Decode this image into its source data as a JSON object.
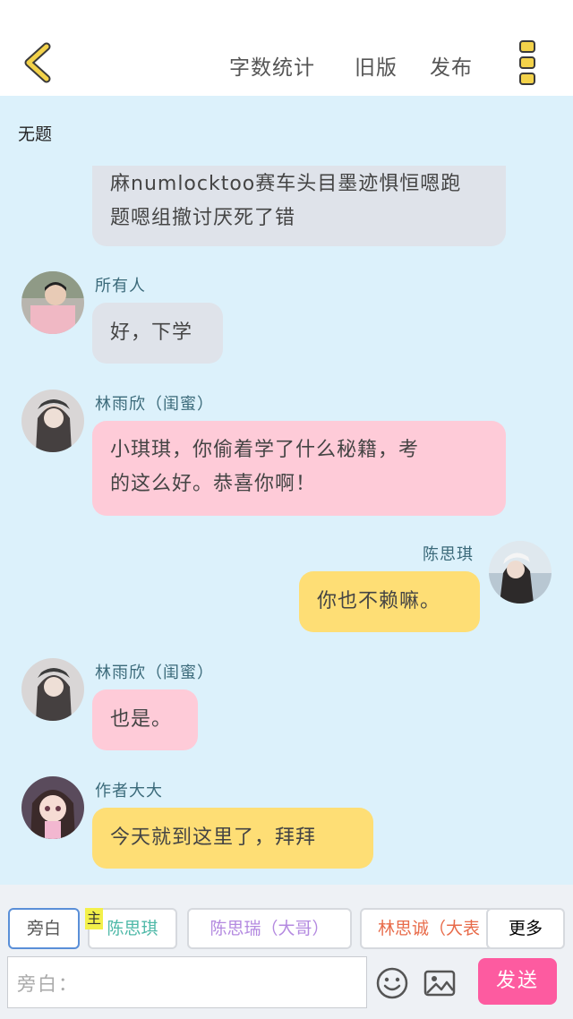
{
  "header": {
    "word_count_label": "字数统计",
    "old_version_label": "旧版",
    "publish_label": "发布"
  },
  "doc": {
    "title": "无题"
  },
  "messages": [
    {
      "sender": "",
      "text_lines": [
        "麻numlocktoo赛车头目墨迹惧恒嗯跑",
        "题嗯组撤讨厌死了错"
      ],
      "color": "gray"
    },
    {
      "sender": "所有人",
      "text": "好，下学",
      "color": "gray"
    },
    {
      "sender": "林雨欣（闺蜜）",
      "text_lines": [
        "小琪琪，你偷着学了什么秘籍，考",
        "的这么好。恭喜你啊！"
      ],
      "color": "pink"
    },
    {
      "sender": "陈思琪",
      "text": "你也不赖嘛。",
      "color": "yellow"
    },
    {
      "sender": "林雨欣（闺蜜）",
      "text": "也是。",
      "color": "pink"
    },
    {
      "sender": "作者大大",
      "text": "今天就到这里了，拜拜",
      "color": "yellow"
    }
  ],
  "roles": {
    "narration": "旁白",
    "main_tag": "主",
    "chen_siqi": "陈思琪",
    "chen_sirui": "陈思瑞（大哥）",
    "lin_sicheng": "林思诚（大表",
    "more": "更多"
  },
  "composer": {
    "placeholder": "旁白：",
    "send_label": "发送"
  },
  "colors": {
    "chat_bg": "#dcf1fb",
    "bubble_gray": "#dfe3ea",
    "bubble_pink": "#fecbd8",
    "bubble_yellow": "#fede75",
    "send": "#fd5ba0",
    "accent_yellow": "#f3d24a"
  }
}
